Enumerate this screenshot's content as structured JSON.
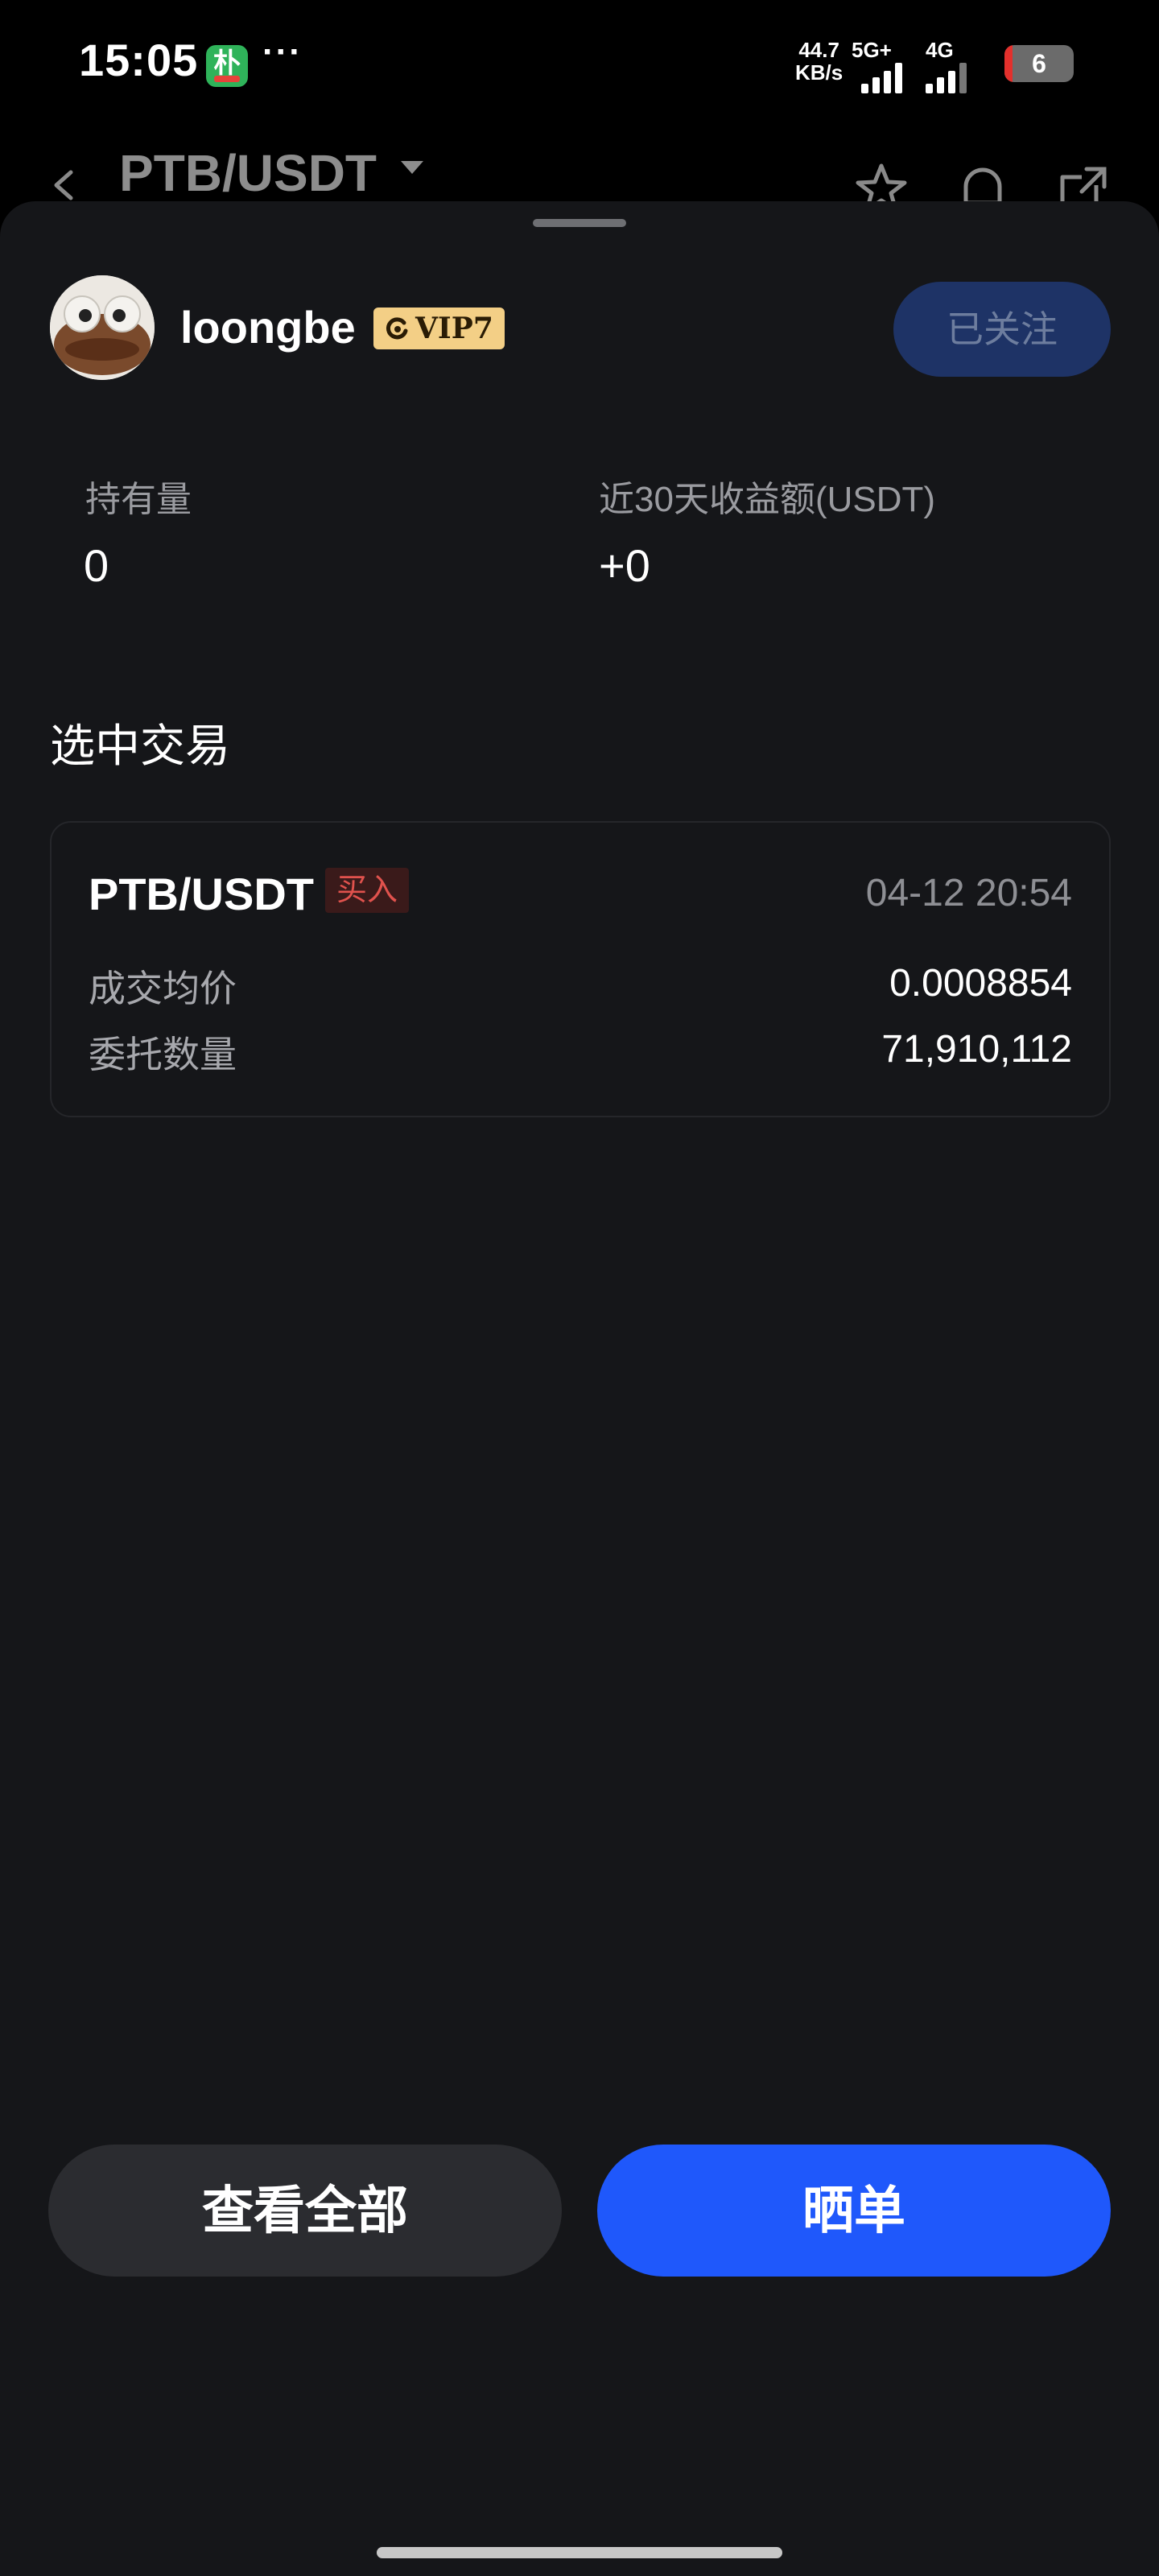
{
  "status_bar": {
    "time": "15:05",
    "app_badge_glyph": "朴",
    "more": "···",
    "net_speed_value": "44.7",
    "net_speed_unit": "KB/s",
    "signal1_label": "5G+",
    "signal2_label": "4G",
    "battery_level": "6"
  },
  "header": {
    "pair": "PTB/USDT",
    "icons": [
      "back-icon",
      "star-icon",
      "bell-icon",
      "share-icon"
    ]
  },
  "profile": {
    "username": "loongbe",
    "vip_label": "VIP7",
    "follow_label": "已关注"
  },
  "stats": {
    "holding_label": "持有量",
    "holding_value": "0",
    "profit_label": "近30天收益额(USDT)",
    "profit_value": "+0"
  },
  "section_title": "选中交易",
  "trade": {
    "pair": "PTB/USDT",
    "side": "买入",
    "time": "04-12 20:54",
    "rows": [
      {
        "label": "成交均价",
        "value": "0.0008854"
      },
      {
        "label": "委托数量",
        "value": "71,910,112"
      }
    ]
  },
  "actions": {
    "view_all": "查看全部",
    "share": "晒单"
  },
  "colors": {
    "sheet_bg": "#151619",
    "primary": "#1f58fb",
    "buy": "#e0524d",
    "vip_gold": "#f3cf86"
  }
}
